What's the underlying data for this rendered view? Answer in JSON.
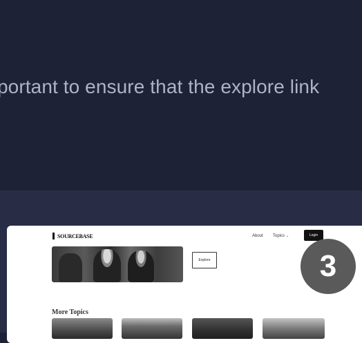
{
  "caption": {
    "text": "portant to ensure that the explore link"
  },
  "site": {
    "logo_text": "SOURCEBASE",
    "nav": {
      "about": "About",
      "topics": "Topics",
      "topics_chevron": "⌄",
      "login": "Login"
    },
    "explore_button": "Explore",
    "more_topics_heading": "More Topics"
  },
  "step_badge": "3",
  "colors": {
    "background_top": "#1e2237",
    "background_bottom": "#282d45",
    "caption_text": "#aeb3c6",
    "badge": "#5a5a5a"
  }
}
